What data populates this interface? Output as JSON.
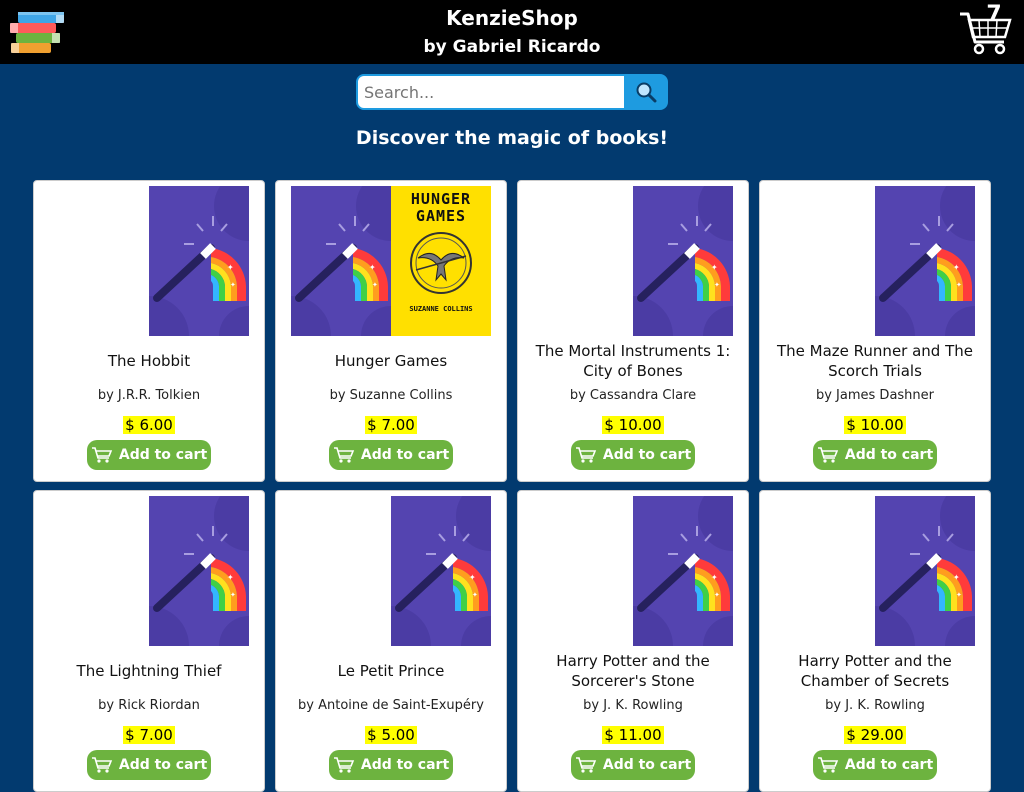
{
  "header": {
    "title": "KenzieShop",
    "subtitle": "by Gabriel Ricardo",
    "cart_count": "7",
    "logo_icon": "books-stack-icon",
    "cart_icon": "shopping-cart-icon"
  },
  "search": {
    "placeholder": "Search...",
    "value": "",
    "button_icon": "search-icon"
  },
  "tagline": "Discover the magic of books!",
  "add_to_cart_label": "Add to cart",
  "books": [
    {
      "title": "The Hobbit",
      "author": "by J.R.R. Tolkien",
      "price": "$ 6.00"
    },
    {
      "title": "Hunger Games",
      "author": "by Suzanne Collins",
      "price": "$ 7.00",
      "cover_title": "HUNGER GAMES",
      "cover_author": "SUZANNE COLLINS"
    },
    {
      "title": "The Mortal Instruments 1: City of Bones",
      "author": "by Cassandra Clare",
      "price": "$ 10.00"
    },
    {
      "title": "The Maze Runner and The Scorch Trials",
      "author": "by James Dashner",
      "price": "$ 10.00"
    },
    {
      "title": "The Lightning Thief",
      "author": "by Rick Riordan",
      "price": "$ 7.00"
    },
    {
      "title": "Le Petit Prince",
      "author": "by Antoine de Saint-Exupéry",
      "price": "$ 5.00"
    },
    {
      "title": "Harry Potter and the Sorcerer's Stone",
      "author": "by J. K. Rowling",
      "price": "$ 11.00"
    },
    {
      "title": "Harry Potter and the Chamber of Secrets",
      "author": "by J. K. Rowling",
      "price": "$ 29.00"
    }
  ],
  "colors": {
    "background": "#023a6f",
    "header": "#000000",
    "accent": "#1e9be0",
    "button": "#6db33f",
    "price_highlight": "#ffff00",
    "cover_purple": "#5444b0"
  }
}
